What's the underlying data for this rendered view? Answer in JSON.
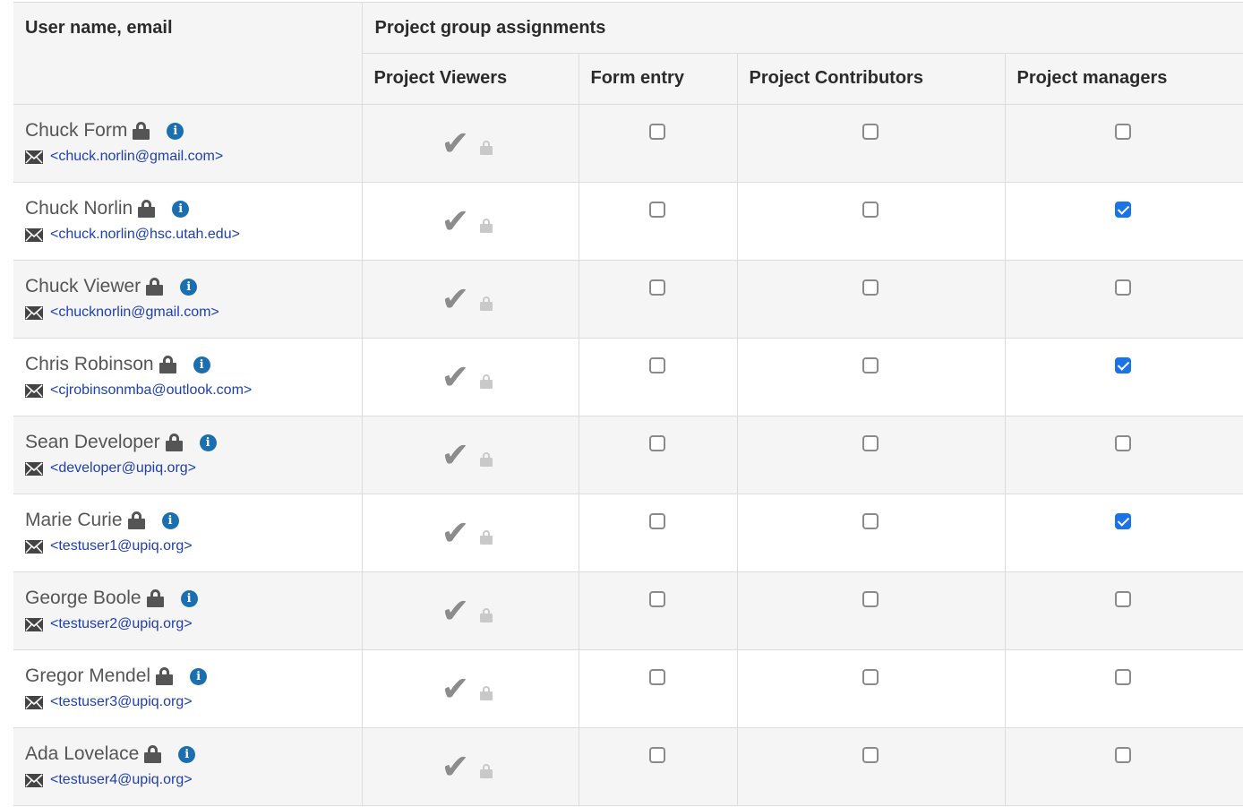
{
  "header": {
    "user_col": "User name, email",
    "group_title": "Project group assignments",
    "columns": [
      "Project Viewers",
      "Form entry",
      "Project Contributors",
      "Project managers"
    ]
  },
  "icons": {
    "lock": "lock-icon",
    "info": "info-icon",
    "email": "envelope-icon",
    "viewer_check": "checkmark-icon",
    "viewer_lock": "lock-icon"
  },
  "colors": {
    "email_link": "#1f3fb0",
    "info_badge": "#1b6fb0",
    "checkbox_checked": "#1a73e8"
  },
  "users": [
    {
      "name": "Chuck Form",
      "email": "<chuck.norlin@gmail.com>",
      "form_entry": false,
      "contributors": false,
      "managers": false
    },
    {
      "name": "Chuck Norlin",
      "email": "<chuck.norlin@hsc.utah.edu>",
      "form_entry": false,
      "contributors": false,
      "managers": true
    },
    {
      "name": "Chuck Viewer",
      "email": "<chucknorlin@gmail.com>",
      "form_entry": false,
      "contributors": false,
      "managers": false
    },
    {
      "name": "Chris Robinson",
      "email": "<cjrobinsonmba@outlook.com>",
      "form_entry": false,
      "contributors": false,
      "managers": true
    },
    {
      "name": "Sean Developer",
      "email": "<developer@upiq.org>",
      "form_entry": false,
      "contributors": false,
      "managers": false
    },
    {
      "name": "Marie Curie",
      "email": "<testuser1@upiq.org>",
      "form_entry": false,
      "contributors": false,
      "managers": true
    },
    {
      "name": "George Boole",
      "email": "<testuser2@upiq.org>",
      "form_entry": false,
      "contributors": false,
      "managers": false
    },
    {
      "name": "Gregor Mendel",
      "email": "<testuser3@upiq.org>",
      "form_entry": false,
      "contributors": false,
      "managers": false
    },
    {
      "name": "Ada Lovelace",
      "email": "<testuser4@upiq.org>",
      "form_entry": false,
      "contributors": false,
      "managers": false
    }
  ]
}
